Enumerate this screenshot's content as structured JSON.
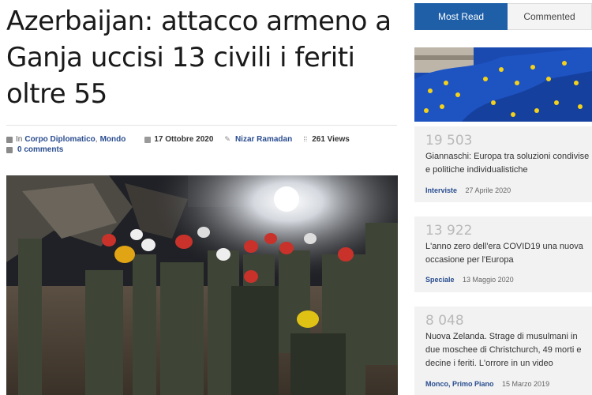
{
  "article": {
    "headline": "Azerbaijan: attacco armeno a Ganja uccisi 13 civili i feriti oltre 55",
    "meta": {
      "in_label": "In",
      "category_1": "Corpo Diplomatico",
      "comma": ",",
      "category_2": "Mondo",
      "date": "17 Ottobre 2020",
      "author": "Nizar Ramadan",
      "views": "261 Views",
      "comments": "0 comments"
    },
    "photo_alt": "photo"
  },
  "sidebar": {
    "tabs": [
      {
        "label": "Most Read"
      },
      {
        "label": "Commented"
      }
    ],
    "items": [
      {
        "number": "19 503",
        "title": "Giannaschi: Europa tra soluzioni condivise e politiche individualistiche",
        "category": "Interviste",
        "date": "27 Aprile 2020"
      },
      {
        "number": "13 922",
        "title": "L'anno zero dell'era COVID19 una nuova occasione per l'Europa",
        "category": "Speciale",
        "date": "13 Maggio 2020"
      },
      {
        "number": "8 048",
        "title": "Nuova Zelanda. Strage di musulmani in due moschee di Christchurch, 49 morti e decine i feriti. L'orrore in un video",
        "category": "Monco, Primo Piano",
        "date": "15 Marzo 2019"
      }
    ]
  },
  "colors": {
    "accent": "#1e5fa8",
    "link": "#2a4d8f",
    "card_bg": "#f2f2f2",
    "number_grey": "#b9b9b9"
  },
  "icons": [
    "folder-icon",
    "calendar-icon",
    "pencil-icon",
    "views-icon",
    "comment-icon"
  ]
}
